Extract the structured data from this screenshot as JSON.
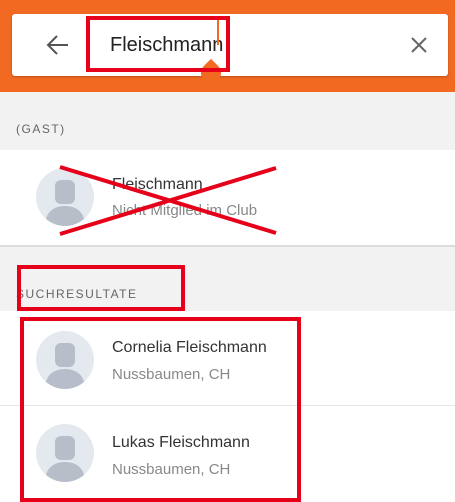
{
  "search": {
    "query": "Fleischmann",
    "back_icon": "arrow-left-icon",
    "clear_icon": "close-icon"
  },
  "colors": {
    "accent": "#f26a21",
    "highlight": "#e6001a",
    "section_bg": "#f2f2f2"
  },
  "guest_section": {
    "label": "(GAST)",
    "item": {
      "name": "Fleischmann",
      "subtitle": "Nicht Mitglied im Club"
    }
  },
  "results_section": {
    "label": "SUCHRESULTATE",
    "items": [
      {
        "name": "Cornelia Fleischmann",
        "location": "Nussbaumen, CH"
      },
      {
        "name": "Lukas Fleischmann",
        "location": "Nussbaumen, CH"
      }
    ]
  }
}
